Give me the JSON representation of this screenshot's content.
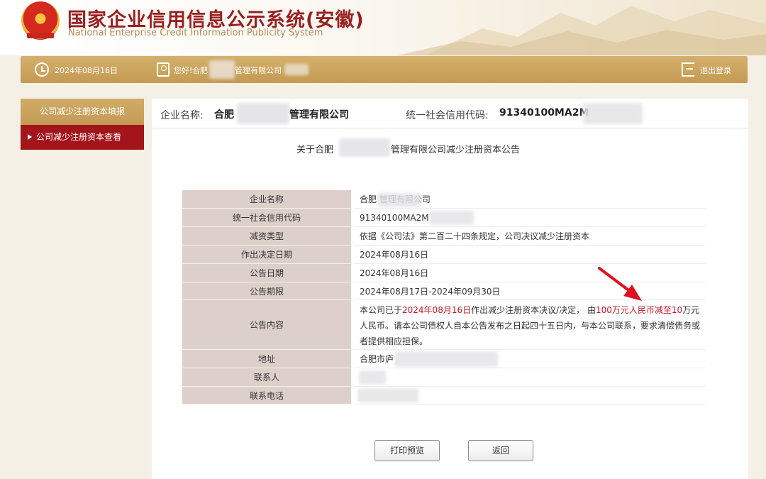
{
  "header": {
    "title": "国家企业信用信息公示系统(安徽)",
    "subtitle": "National Enterprise Credit Information Publicity System"
  },
  "status_bar": {
    "date": "2024年08月16日",
    "greeting": "您好!",
    "company_head": "合肥",
    "company_tail": "管理有限公司",
    "logout": "退出登录"
  },
  "sidebar": {
    "items": [
      {
        "label": "公司减少注册资本填报"
      },
      {
        "label": "公司减少注册资本查看"
      }
    ]
  },
  "info_bar": {
    "company_label": "企业名称:",
    "company_value_head": "合肥",
    "company_value_tail": "管理有限公司",
    "code_label": "统一社会信用代码:",
    "code_value": "91340100MA2M"
  },
  "notice_title": {
    "head": "关于合肥",
    "tail": "管理有限公司减少注册资本公告"
  },
  "table": {
    "rows": [
      {
        "label": "企业名称",
        "value": "合肥  管理有限公司"
      },
      {
        "label": "统一社会信用代码",
        "value": "91340100MA2M"
      },
      {
        "label": "减资类型",
        "value": "依据《公司法》第二百二十四条规定，公司决议减少注册资本"
      },
      {
        "label": "作出决定日期",
        "value": "2024年08月16日"
      },
      {
        "label": "公告日期",
        "value": "2024年08月16日"
      },
      {
        "label": "公告期限",
        "value": "2024年08月17日-2024年09月30日"
      },
      {
        "label": "公告内容",
        "value": ""
      },
      {
        "label": "地址",
        "value": "合肥市庐"
      },
      {
        "label": "联系人",
        "value": ""
      },
      {
        "label": "联系电话",
        "value": ""
      }
    ],
    "content": {
      "p1": "本公司已于",
      "date": "2024年08月16日",
      "p2": "作出减少注册资本决议/决定，  由",
      "from_amount": "100",
      "p3": "万元人民币减至",
      "to_amount": "10",
      "p4": "万元人民币。请本公司债权人自本公告发布之日起四十五日内，与本公司联系，要求清偿债务或者提供相应担保。"
    }
  },
  "buttons": {
    "print": "打印预览",
    "back": "返回"
  },
  "colors": {
    "accent_gold": "#c49a52",
    "active_red": "#a3141b",
    "highlight_red": "#c0182a",
    "annotation_arrow": "#e0101e"
  }
}
